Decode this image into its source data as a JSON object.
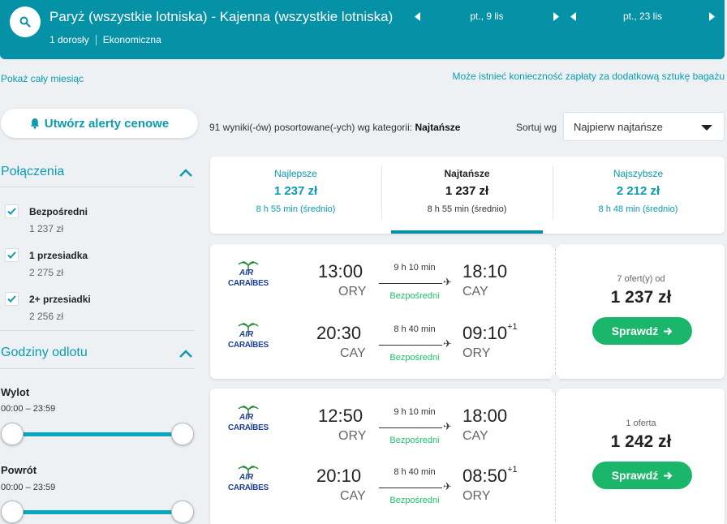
{
  "header": {
    "route": "Paryż (wszystkie lotniska) - Kajenna (wszystkie lotniska)",
    "passengers": "1 dorosły",
    "cabin": "Ekonomiczna",
    "depart_date": "pt., 9 lis",
    "return_date": "pt., 23 lis"
  },
  "links": {
    "show_month": "Pokaż cały miesiąc",
    "baggage_note": "Może istnieć konieczność zapłaty za dodatkową sztukę bagażu"
  },
  "sidebar": {
    "alert_label": "Utwórz alerty cenowe",
    "connections_title": "Połączenia",
    "filters": [
      {
        "name": "Bezpośredni",
        "price": "1 237 zł"
      },
      {
        "name": "1 przesiadka",
        "price": "2 275 zł"
      },
      {
        "name": "2+ przesiadki",
        "price": "2 256 zł"
      }
    ],
    "times_title": "Godziny odlotu",
    "outbound_label": "Wylot",
    "outbound_range": "00:00 – 23:59",
    "return_label": "Powrót",
    "return_range": "00:00 – 23:59"
  },
  "results": {
    "count_text": "91 wyniki(-ów) posortowane(-ych) wg kategorii:",
    "sort_category": "Najtańsze",
    "sort_by_label": "Sortuj wg",
    "sort_selected": "Najpierw najtańsze"
  },
  "tabs": [
    {
      "label": "Najlepsze",
      "price": "1 237 zł",
      "duration": "8 h 55 min (średnio)"
    },
    {
      "label": "Najtańsze",
      "price": "1 237 zł",
      "duration": "8 h 55 min (średnio)"
    },
    {
      "label": "Najszybsze",
      "price": "2 212 zł",
      "duration": "8 h 48 min (średnio)"
    }
  ],
  "flights": [
    {
      "offers": "7 ofert(y) od",
      "price": "1 237 zł",
      "button": "Sprawdź",
      "legs": [
        {
          "airline_top": "AIR",
          "airline_bottom": "CARAÏBES",
          "dep_time": "13:00",
          "dep_code": "ORY",
          "duration": "9 h 10 min",
          "stops": "Bezpośredni",
          "arr_time": "18:10",
          "arr_code": "CAY",
          "day_offset": ""
        },
        {
          "airline_top": "AIR",
          "airline_bottom": "CARAÏBES",
          "dep_time": "20:30",
          "dep_code": "CAY",
          "duration": "8 h 40 min",
          "stops": "Bezpośredni",
          "arr_time": "09:10",
          "arr_code": "ORY",
          "day_offset": "+1"
        }
      ]
    },
    {
      "offers": "1 oferta",
      "price": "1 242 zł",
      "button": "Sprawdź",
      "legs": [
        {
          "airline_top": "AIR",
          "airline_bottom": "CARAÏBES",
          "dep_time": "12:50",
          "dep_code": "ORY",
          "duration": "9 h 10 min",
          "stops": "Bezpośredni",
          "arr_time": "18:00",
          "arr_code": "CAY",
          "day_offset": ""
        },
        {
          "airline_top": "AIR",
          "airline_bottom": "CARAÏBES",
          "dep_time": "20:10",
          "dep_code": "CAY",
          "duration": "8 h 40 min",
          "stops": "Bezpośredni",
          "arr_time": "08:50",
          "arr_code": "ORY",
          "day_offset": "+1"
        }
      ]
    }
  ],
  "colors": {
    "header_bg": "#0591a6",
    "accent": "#0a9bb0",
    "cta_green": "#1ab76a",
    "direct_green": "#1fbf6b",
    "airline_blue": "#1c3f93"
  },
  "icons": {
    "search": "search-icon",
    "bell": "bell-icon",
    "prev": "chevron-left-icon",
    "next": "chevron-right-icon",
    "collapse": "chevron-up-icon",
    "check": "checkmark-icon",
    "plane": "plane-icon",
    "arrow": "arrow-right-icon",
    "caret": "caret-down-icon"
  }
}
